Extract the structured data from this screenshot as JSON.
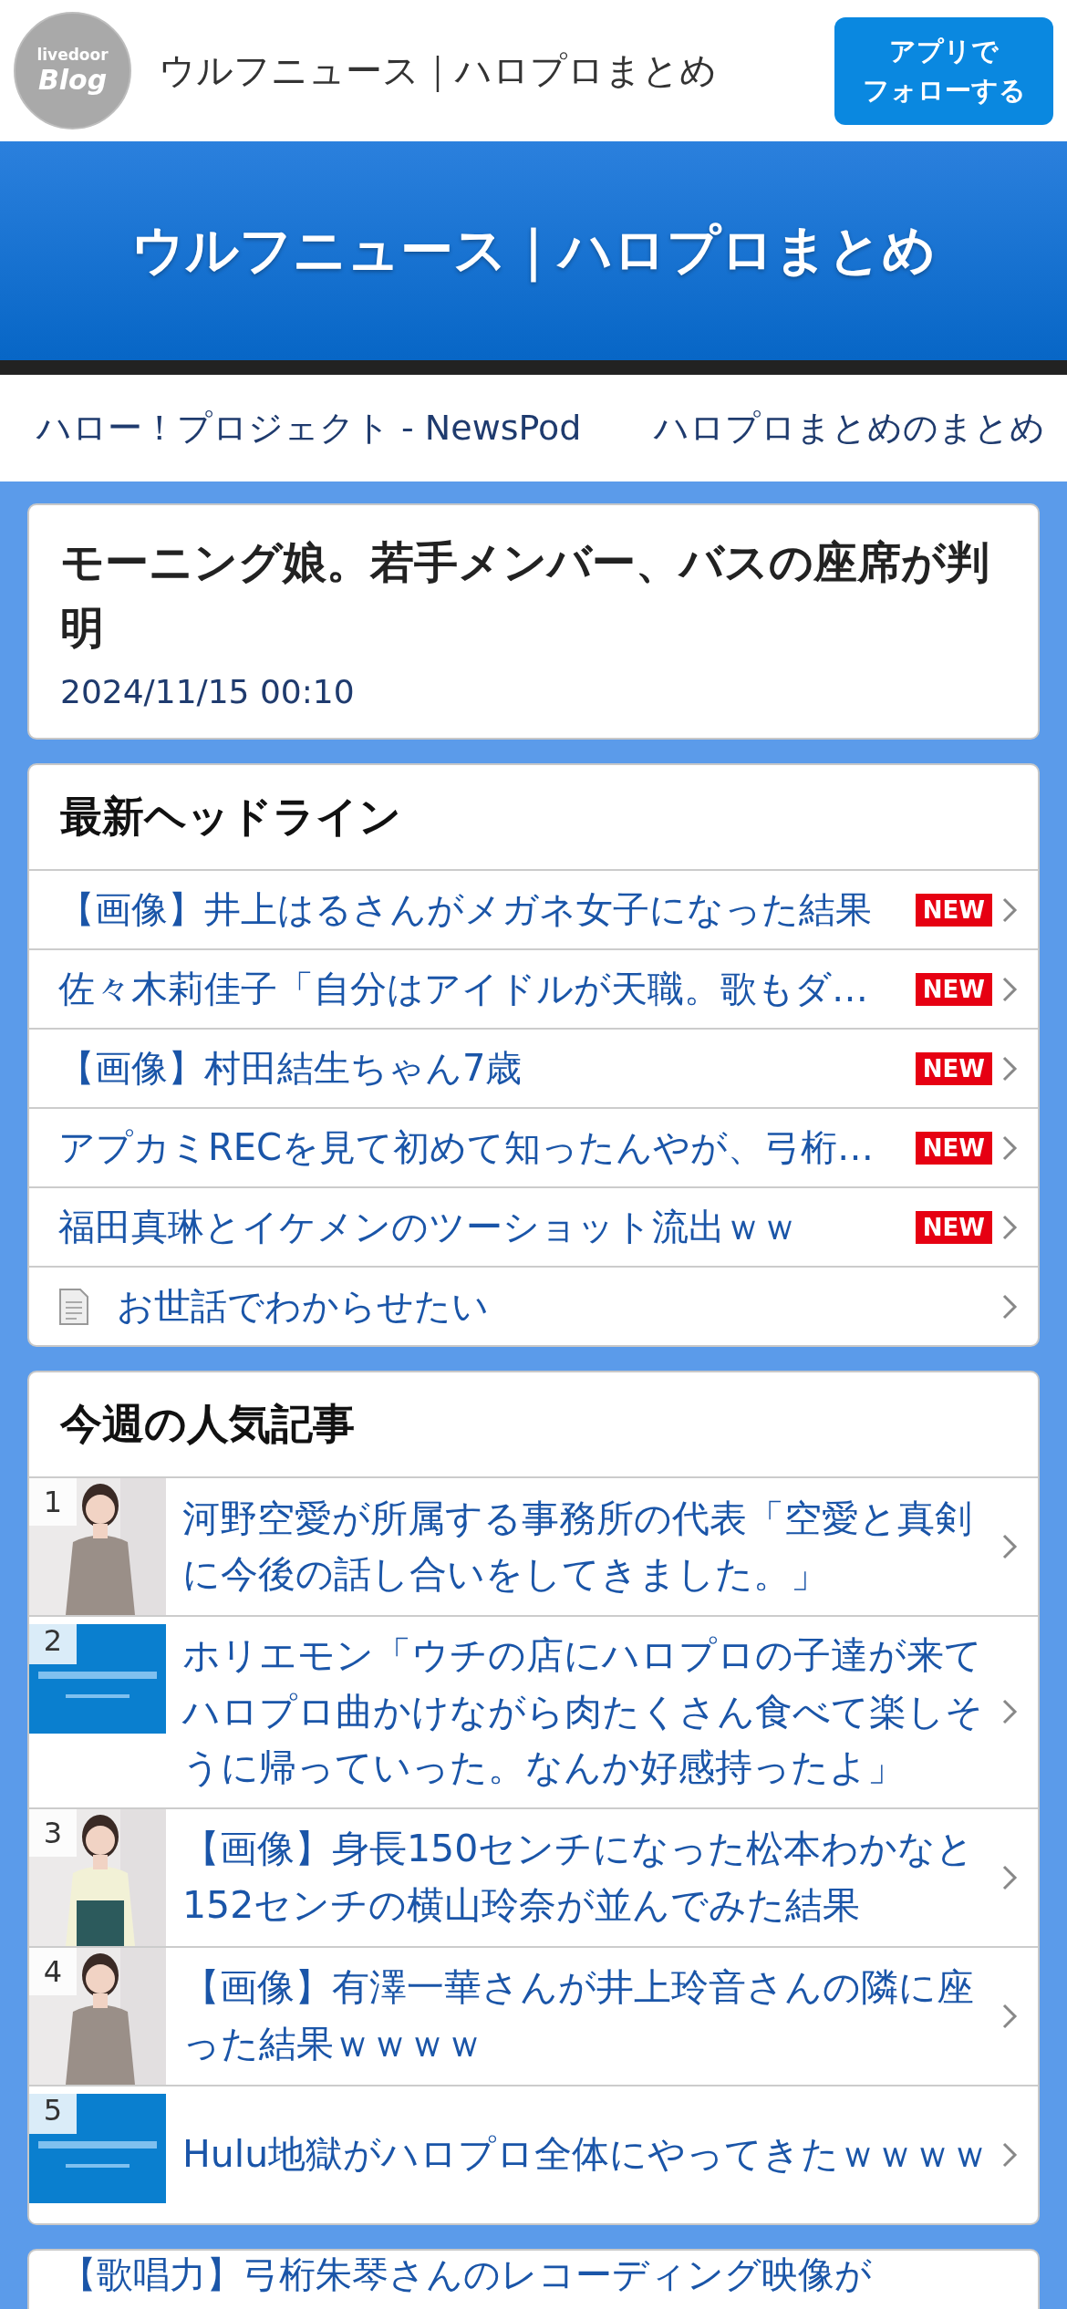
{
  "header": {
    "logo_top": "livedoor",
    "logo_main": "Blog",
    "title": "ウルフニュース｜ハロプロまとめ",
    "follow_button": [
      "アプリで",
      "フォローする"
    ]
  },
  "banner": {
    "title": "ウルフニュース｜ハロプロまとめ"
  },
  "nav": {
    "links": [
      "ハロー！プロジェクト - NewsPod",
      "ハロプロまとめのまとめ"
    ]
  },
  "article": {
    "title": "モーニング娘。若手メンバー、バスの座席が判明",
    "date": "2024/11/15 00:10"
  },
  "headlines": {
    "title": "最新ヘッドライン",
    "items": [
      {
        "text": "【画像】井上はるさんがメガネ女子になった結果",
        "new": true,
        "badge": "NEW",
        "kind": "link"
      },
      {
        "text": "佐々木莉佳子「自分はアイドルが天職。歌もダ…",
        "new": true,
        "badge": "NEW",
        "kind": "link"
      },
      {
        "text": "【画像】村田結生ちゃん7歳",
        "new": true,
        "badge": "NEW",
        "kind": "link"
      },
      {
        "text": "アプカミRECを見て初めて知ったんやが、弓桁…",
        "new": true,
        "badge": "NEW",
        "kind": "link"
      },
      {
        "text": "福田真琳とイケメンのツーショット流出ｗｗ",
        "new": true,
        "badge": "NEW",
        "kind": "link"
      },
      {
        "text": "お世話でわからせたい",
        "new": false,
        "kind": "page"
      }
    ]
  },
  "popular": {
    "title": "今週の人気記事",
    "items": [
      {
        "rank": "1",
        "title": "河野空愛が所属する事務所の代表「空愛と真剣に今後の話し合いをしてきました。」",
        "kind": "person"
      },
      {
        "rank": "2",
        "title": "ホリエモン「ウチの店にハロプロの子達が来てハロプロ曲かけながら肉たくさん食べて楽しそうに帰っていった。なんか好感持ったよ」",
        "kind": "banner"
      },
      {
        "rank": "3",
        "title": "【画像】身長150センチになった松本わかなと152センチの横山玲奈が並んでみた結果",
        "kind": "person"
      },
      {
        "rank": "4",
        "title": "【画像】有澤一華さんが井上玲音さんの隣に座った結果ｗｗｗｗ",
        "kind": "person"
      },
      {
        "rank": "5",
        "title": "Hulu地獄がハロプロ全体にやってきたｗｗｗｗ",
        "kind": "banner"
      }
    ]
  },
  "next_card": {
    "title": "【歌唱力】弓桁朱琴さんのレコーディング映像が"
  }
}
